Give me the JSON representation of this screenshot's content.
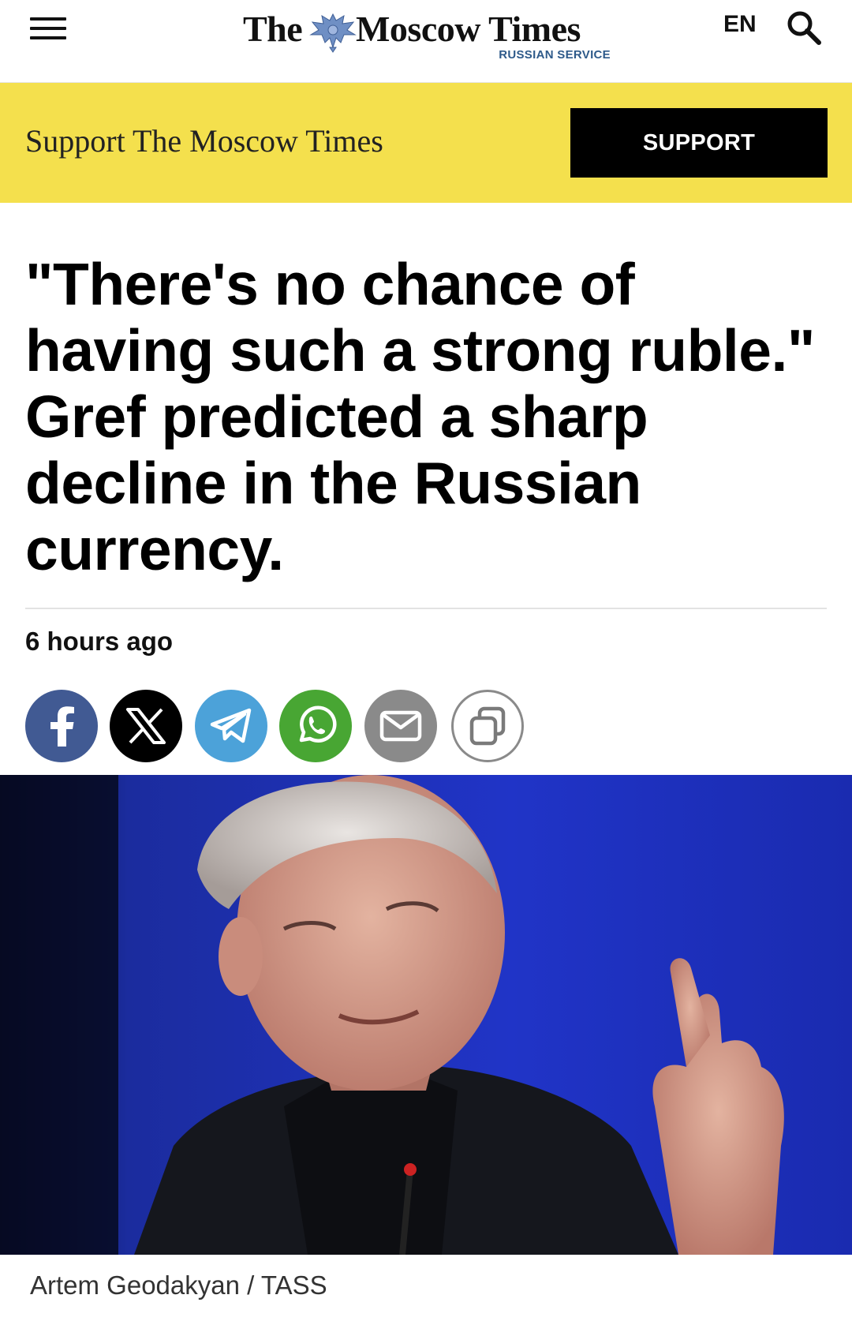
{
  "header": {
    "logo_the": "The",
    "logo_main": "Moscow Times",
    "logo_subtitle": "RUSSIAN SERVICE",
    "language": "EN",
    "menu_icon": "hamburger-menu-icon",
    "search_icon": "search-icon"
  },
  "banner": {
    "text": "Support The Moscow Times",
    "button_label": "SUPPORT",
    "background_color": "#f4e04d"
  },
  "article": {
    "headline": "\"There's no chance of having such a strong ruble.\" Gref predicted a sharp decline in the Russian currency.",
    "timestamp": "6 hours ago",
    "share_buttons": [
      {
        "network": "facebook",
        "icon": "facebook-icon",
        "color": "#415a93"
      },
      {
        "network": "x",
        "icon": "x-icon",
        "color": "#000000"
      },
      {
        "network": "telegram",
        "icon": "telegram-icon",
        "color": "#4ca2d9"
      },
      {
        "network": "whatsapp",
        "icon": "whatsapp-icon",
        "color": "#48a633"
      },
      {
        "network": "email",
        "icon": "mail-icon",
        "color": "#8a8a8a"
      },
      {
        "network": "copy-link",
        "icon": "copy-icon",
        "color": "#8a8a8a"
      }
    ],
    "photo_caption": "Artem Geodakyan / TASS"
  }
}
